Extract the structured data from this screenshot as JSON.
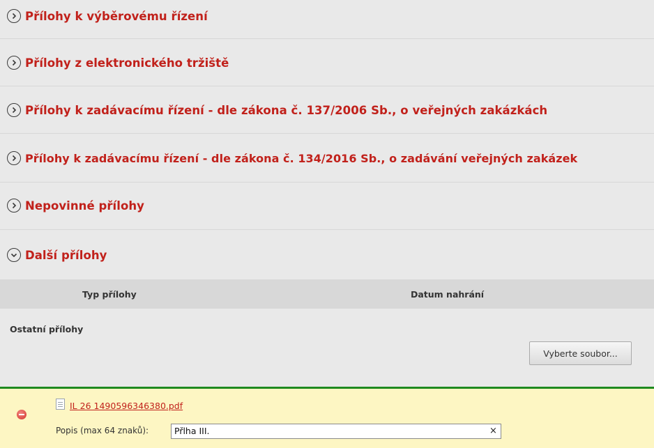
{
  "sections": [
    {
      "title": "Přílohy k výběrovému řízení",
      "expanded": false
    },
    {
      "title": "Přílohy z elektronického tržiště",
      "expanded": false
    },
    {
      "title": "Přílohy k zadávacímu řízení - dle zákona č. 137/2006 Sb., o veřejných zakázkách",
      "expanded": false
    },
    {
      "title": "Přílohy k zadávacímu řízení - dle zákona č. 134/2016 Sb., o zadávání veřejných zakázek",
      "expanded": false
    },
    {
      "title": "Nepovinné přílohy",
      "expanded": false
    },
    {
      "title": "Další přílohy",
      "expanded": true
    }
  ],
  "table": {
    "col_type": "Typ přílohy",
    "col_date": "Datum nahrání"
  },
  "other": {
    "label": "Ostatní přílohy",
    "select_file_button": "Vyberte soubor..."
  },
  "file": {
    "name": "IL 26 1490596346380.pdf",
    "description_label": "Popis (max 64 znaků):",
    "description_value": "Přlha III.",
    "clear_symbol": "×",
    "icon": "document-icon",
    "remove_icon": "remove-icon"
  },
  "colors": {
    "accent_red": "#c1211b",
    "success_green": "#1f8a1f",
    "highlight_yellow": "#fdf6c3"
  }
}
